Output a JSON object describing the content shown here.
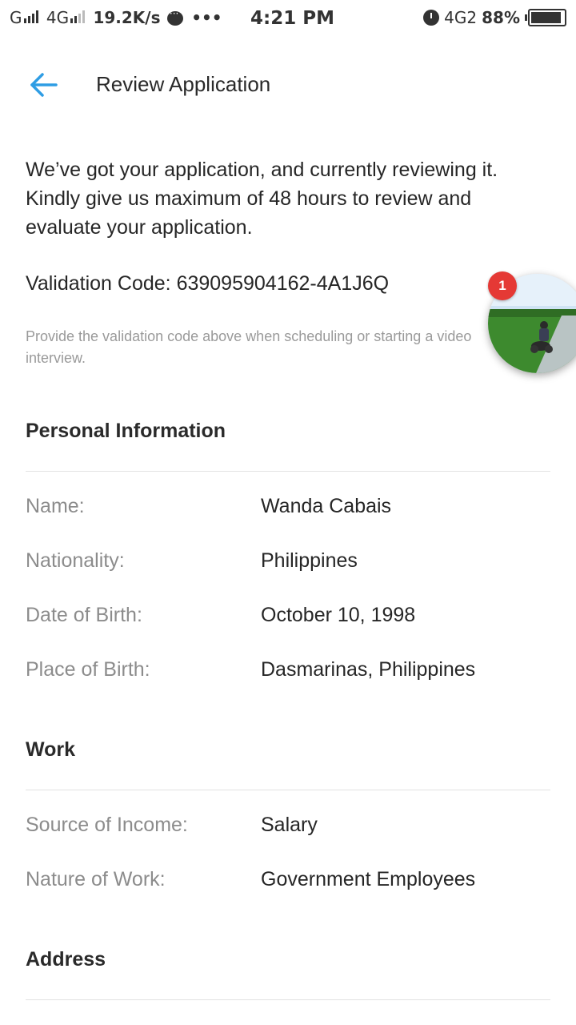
{
  "status_bar": {
    "carrier1": "G",
    "carrier2": "4G",
    "speed": "19.2K/s",
    "more": "•••",
    "time": "4:21 PM",
    "network": "4G2",
    "battery": "88%"
  },
  "header": {
    "back_icon": "arrow-left-icon",
    "title": "Review Application"
  },
  "intro_text": "We’ve got your application, and currently reviewing it. Kindly give us maximum of 48 hours to review and evaluate your application.",
  "validation": {
    "label": "Validation Code:",
    "code": "639095904162-4A1J6Q",
    "hint": "Provide the validation code above when scheduling or starting a video interview."
  },
  "personal": {
    "title": "Personal Information",
    "fields": [
      {
        "label": "Name:",
        "value": "Wanda Cabais"
      },
      {
        "label": "Nationality:",
        "value": "Philippines"
      },
      {
        "label": "Date of Birth:",
        "value": "October 10, 1998"
      },
      {
        "label": "Place of Birth:",
        "value": "Dasmarinas, Philippines"
      }
    ]
  },
  "work": {
    "title": "Work",
    "fields": [
      {
        "label": "Source of Income:",
        "value": "Salary"
      },
      {
        "label": "Nature of Work:",
        "value": "Government Employees"
      }
    ]
  },
  "address": {
    "title": "Address"
  },
  "chat_head": {
    "badge": "1"
  },
  "colors": {
    "accent": "#2f9de4",
    "badge": "#e53935",
    "label": "#8c8c8c",
    "value": "#262626"
  }
}
